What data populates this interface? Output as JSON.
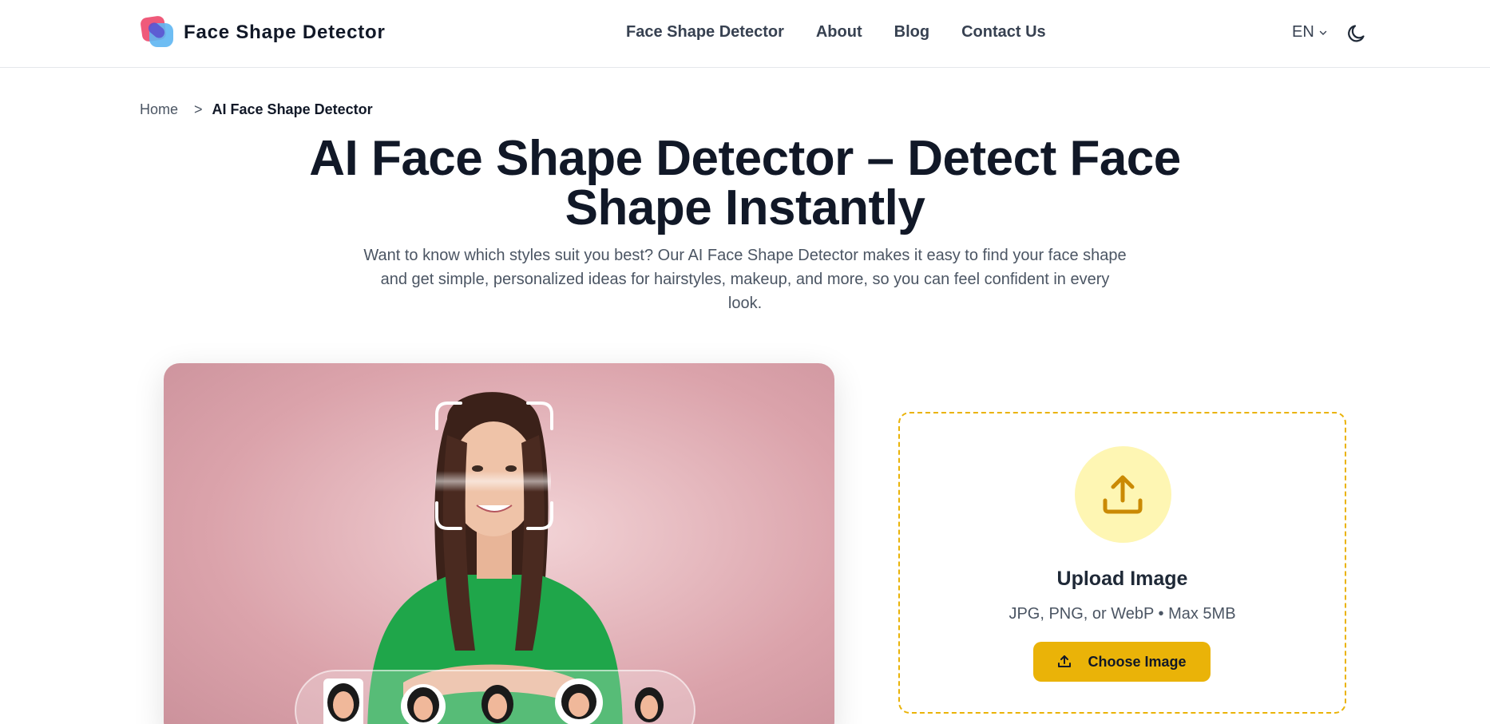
{
  "header": {
    "brand": "Face Shape Detector",
    "nav": [
      "Face Shape Detector",
      "About",
      "Blog",
      "Contact Us"
    ],
    "language": "EN"
  },
  "breadcrumb": {
    "home": "Home",
    "separator": ">",
    "current": "AI Face Shape Detector"
  },
  "hero": {
    "title": "AI Face Shape Detector – Detect Face Shape Instantly",
    "subtitle": "Want to know which styles suit you best? Our AI Face Shape Detector makes it easy to find your face shape and get simple, personalized ideas for hairstyles, makeup, and more, so you can feel confident in every look."
  },
  "upload": {
    "title": "Upload Image",
    "hint": "JPG, PNG, or WebP • Max 5MB",
    "button_label": "Choose Image"
  },
  "colors": {
    "accent": "#eab308",
    "accent_soft": "#fef6b3",
    "text_dark": "#111827",
    "text_muted": "#4b5563"
  },
  "icons": [
    "brand-logo-icon",
    "chevron-down-icon",
    "moon-icon",
    "upload-icon"
  ]
}
